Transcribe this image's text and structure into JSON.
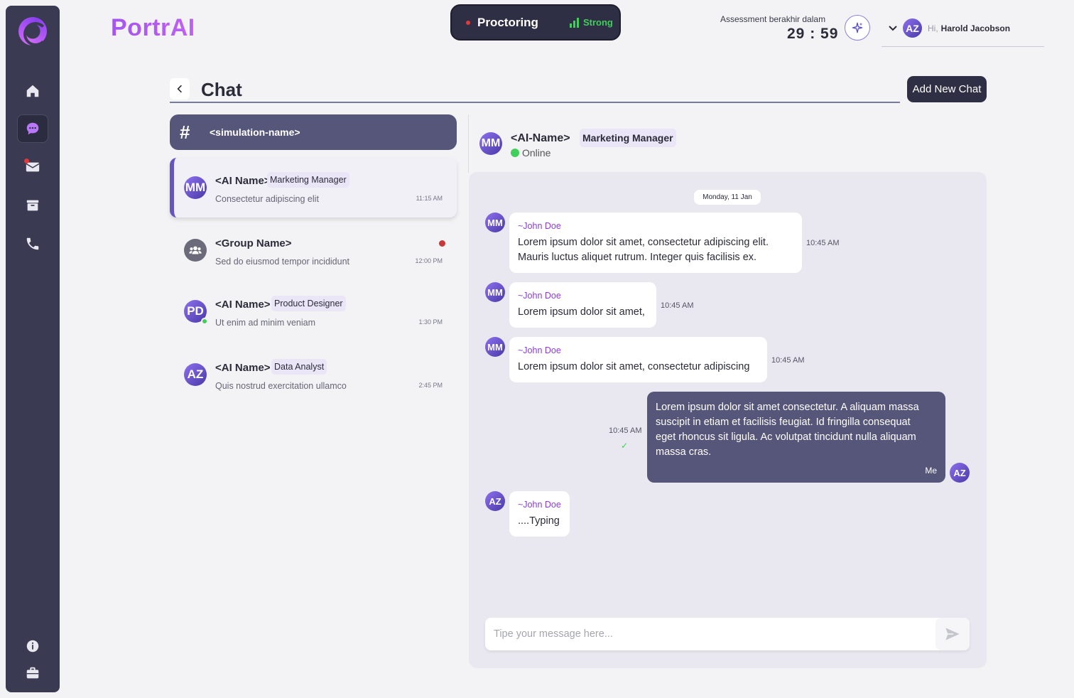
{
  "brand": "PortrAI",
  "proctoring": {
    "label": "Proctoring",
    "signal": "Strong"
  },
  "assessment": {
    "label": "Assessment berakhir dalam",
    "timer": "29 : 59"
  },
  "user": {
    "initials": "AZ",
    "greeting": "Hi,",
    "name": "Harold Jacobson"
  },
  "sidebar": {
    "items": [
      {
        "icon": "home-icon"
      },
      {
        "icon": "chat-icon",
        "active": true
      },
      {
        "icon": "mail-icon",
        "badge": true
      },
      {
        "icon": "archive-icon"
      },
      {
        "icon": "phone-icon"
      },
      {
        "icon": "info-icon"
      },
      {
        "icon": "briefcase-icon"
      }
    ]
  },
  "page": {
    "title": "Chat",
    "add_button": "Add New Chat"
  },
  "simulation": {
    "name": "<simulation-name>"
  },
  "chat_list": [
    {
      "initials": "MM",
      "name": "<AI Name>",
      "tag": "Marketing Manager",
      "preview": "Consectetur adipiscing elit",
      "time": "11:15 AM",
      "active": true
    },
    {
      "initials": "",
      "name": "<Group Name>",
      "tag": "",
      "preview": "Sed do eiusmod tempor incididunt",
      "time": "12:00 PM",
      "unread": true
    },
    {
      "initials": "PD",
      "name": "<AI Name>",
      "tag": "Product Designer",
      "preview": "Ut enim ad minim veniam",
      "time": "1:30 PM",
      "online": true
    },
    {
      "initials": "AZ",
      "name": "<AI Name>",
      "tag": "Data Analyst",
      "preview": "Quis nostrud exercitation ullamco",
      "time": "2:45 PM"
    }
  ],
  "conversation": {
    "initials": "MM",
    "name": "<AI-Name>",
    "tag": "Marketing Manager",
    "status": "Online",
    "date": "Monday, 11 Jan",
    "messages": [
      {
        "initials": "MM",
        "sender": "~John Doe",
        "text": "Lorem ipsum dolor sit amet, consectetur adipiscing elit.\nMauris luctus aliquet rutrum. Integer quis facilisis ex.",
        "time": "10:45 AM"
      },
      {
        "initials": "MM",
        "sender": "~John Doe",
        "text": "Lorem ipsum dolor sit amet,",
        "time": "10:45 AM"
      },
      {
        "initials": "MM",
        "sender": "~John Doe",
        "text": "Lorem ipsum dolor sit amet, consectetur adipiscing",
        "time": "10:45 AM"
      },
      {
        "initials": "AZ",
        "sender": "Me",
        "text": "Lorem ipsum dolor sit amet consectetur. A aliquam massa\nsuscipit in etiam et facilisis feugiat. Id fringilla consequat\neget rhoncus sit ligula. Ac volutpat tincidunt nulla aliquam\nmassa cras.",
        "time": "10:45 AM"
      },
      {
        "initials": "AZ",
        "sender": "~John Doe",
        "text": "....Typing",
        "time": ""
      }
    ],
    "compose_placeholder": "Tipe your message here..."
  }
}
